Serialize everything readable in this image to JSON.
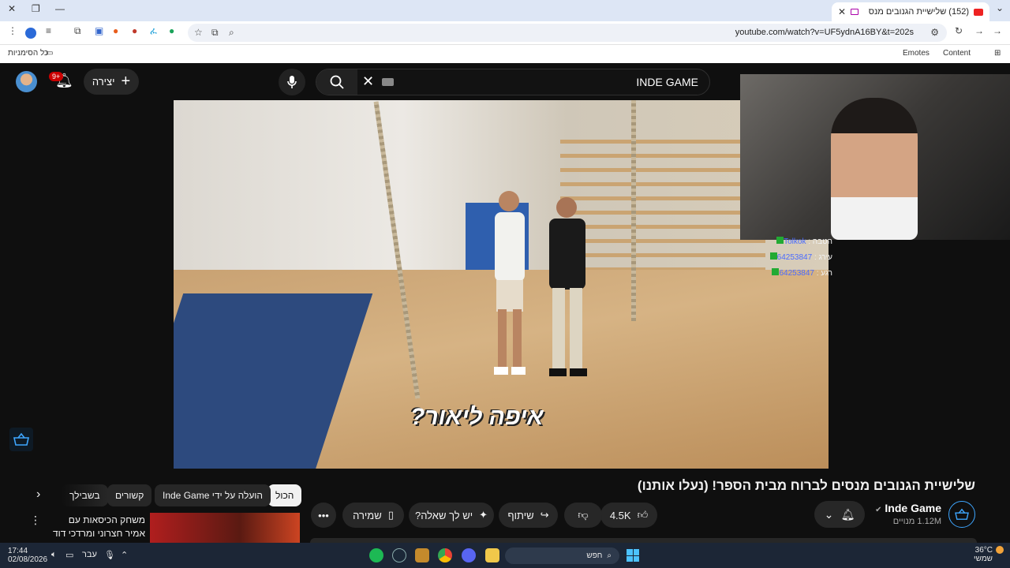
{
  "browser": {
    "tab_title": "(152) שלישיית הגנובים מנס",
    "url": "youtube.com/watch?v=UF5ydnA16BY&t=202s",
    "bookmarks_all": "כל הסימניות",
    "ext_emotes": "Emotes",
    "ext_content": "Content"
  },
  "youtube": {
    "notif_count": "9+",
    "create_label": "יצירה",
    "search_value": "INDE GAME"
  },
  "video": {
    "caption": "איפה ליאור?"
  },
  "chat": [
    {
      "name": "Tolkok",
      "label": "הטבה :"
    },
    {
      "name": "64253847",
      "label": "עירג :"
    },
    {
      "name": "64253847",
      "label": "רגע :"
    }
  ],
  "details": {
    "title": "שלישיית הגנובים מנסים לברוח מבית הספר! (נעלו אותנו)",
    "channel_name": "Inde Game",
    "subscribers": "1.12M מנויים",
    "likes": "4.5K",
    "share": "שיתוף",
    "ask": "יש לך שאלה?",
    "save": "שמירה"
  },
  "chips": {
    "all": "הכול",
    "uploaded_by": "הועלה על ידי Inde Game",
    "related": "קשורים",
    "for_you": "בשבילך"
  },
  "recommendation": {
    "title": "משחק הכיסאות עם אמיר חצרוני ומרדכי דוד 🎮 | ..."
  },
  "taskbar": {
    "time": "17:44",
    "date": "02/08/2026",
    "lang": "עבר",
    "search_placeholder": "חפש",
    "temperature": "36°C",
    "weather_desc": "שמשי"
  },
  "colors": {
    "accent": "#3ea6ff",
    "red": "#cc0000",
    "bg": "#0f0f0f"
  }
}
